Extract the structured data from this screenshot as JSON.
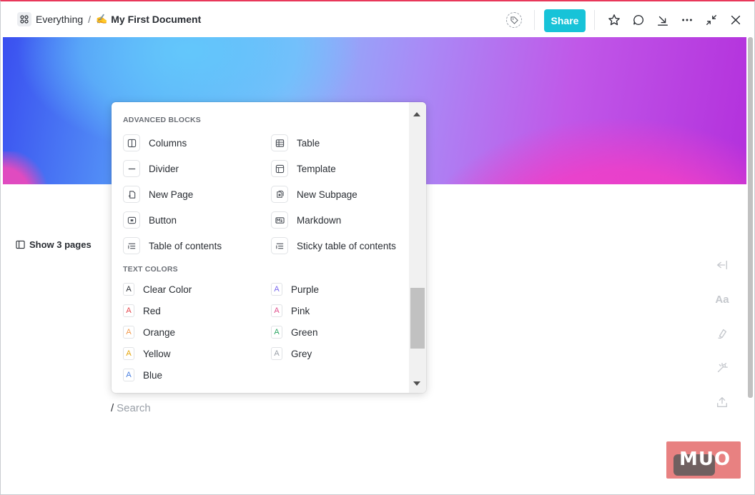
{
  "header": {
    "space_name": "Everything",
    "separator": "/",
    "doc_emoji": "✍️",
    "doc_title": "My First Document",
    "share_label": "Share",
    "icons": [
      "tag-icon",
      "star-icon",
      "comment-icon",
      "download-icon",
      "more-icon",
      "collapse-icon",
      "close-icon"
    ]
  },
  "sidebar": {
    "show_pages_label": "Show 3 pages"
  },
  "menu": {
    "advanced_title": "ADVANCED BLOCKS",
    "blocks": [
      {
        "label": "Columns",
        "icon": "columns-icon"
      },
      {
        "label": "Table",
        "icon": "table-icon"
      },
      {
        "label": "Divider",
        "icon": "divider-icon"
      },
      {
        "label": "Template",
        "icon": "template-icon"
      },
      {
        "label": "New Page",
        "icon": "new-page-icon"
      },
      {
        "label": "New Subpage",
        "icon": "new-subpage-icon"
      },
      {
        "label": "Button",
        "icon": "button-icon"
      },
      {
        "label": "Markdown",
        "icon": "markdown-icon"
      },
      {
        "label": "Table of contents",
        "icon": "toc-icon"
      },
      {
        "label": "Sticky table of contents",
        "icon": "sticky-toc-icon"
      }
    ],
    "colors_title": "TEXT COLORS",
    "color_glyph": "A",
    "colors": [
      {
        "label": "Clear Color",
        "color": "#2a2e34"
      },
      {
        "label": "Purple",
        "color": "#7b68ee"
      },
      {
        "label": "Red",
        "color": "#e5484d"
      },
      {
        "label": "Pink",
        "color": "#e04f8d"
      },
      {
        "label": "Orange",
        "color": "#f2994a"
      },
      {
        "label": "Green",
        "color": "#2ea664"
      },
      {
        "label": "Yellow",
        "color": "#e5a50a"
      },
      {
        "label": "Grey",
        "color": "#9aa0a8"
      },
      {
        "label": "Blue",
        "color": "#4a7fe0"
      }
    ]
  },
  "editor": {
    "slash": "/",
    "search_placeholder": "Search"
  },
  "rail": {
    "aa_label": "Aa"
  },
  "watermark": {
    "text": "MUO"
  },
  "colors": {
    "accent": "#17c3d8",
    "top_border": "#e8385a"
  }
}
